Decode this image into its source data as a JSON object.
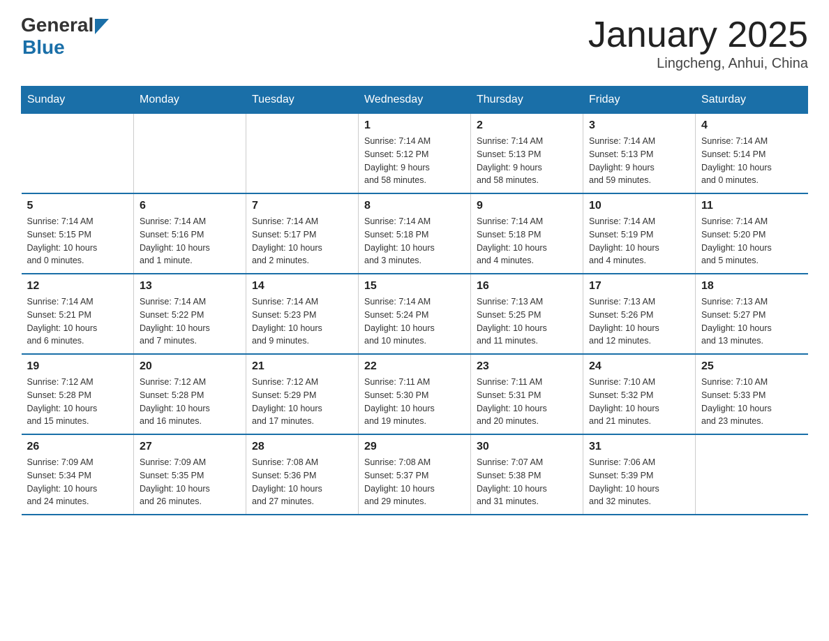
{
  "header": {
    "logo_general": "General",
    "logo_blue": "Blue",
    "month_title": "January 2025",
    "location": "Lingcheng, Anhui, China"
  },
  "weekdays": [
    "Sunday",
    "Monday",
    "Tuesday",
    "Wednesday",
    "Thursday",
    "Friday",
    "Saturday"
  ],
  "weeks": [
    {
      "days": [
        {
          "number": "",
          "info": ""
        },
        {
          "number": "",
          "info": ""
        },
        {
          "number": "",
          "info": ""
        },
        {
          "number": "1",
          "info": "Sunrise: 7:14 AM\nSunset: 5:12 PM\nDaylight: 9 hours\nand 58 minutes."
        },
        {
          "number": "2",
          "info": "Sunrise: 7:14 AM\nSunset: 5:13 PM\nDaylight: 9 hours\nand 58 minutes."
        },
        {
          "number": "3",
          "info": "Sunrise: 7:14 AM\nSunset: 5:13 PM\nDaylight: 9 hours\nand 59 minutes."
        },
        {
          "number": "4",
          "info": "Sunrise: 7:14 AM\nSunset: 5:14 PM\nDaylight: 10 hours\nand 0 minutes."
        }
      ]
    },
    {
      "days": [
        {
          "number": "5",
          "info": "Sunrise: 7:14 AM\nSunset: 5:15 PM\nDaylight: 10 hours\nand 0 minutes."
        },
        {
          "number": "6",
          "info": "Sunrise: 7:14 AM\nSunset: 5:16 PM\nDaylight: 10 hours\nand 1 minute."
        },
        {
          "number": "7",
          "info": "Sunrise: 7:14 AM\nSunset: 5:17 PM\nDaylight: 10 hours\nand 2 minutes."
        },
        {
          "number": "8",
          "info": "Sunrise: 7:14 AM\nSunset: 5:18 PM\nDaylight: 10 hours\nand 3 minutes."
        },
        {
          "number": "9",
          "info": "Sunrise: 7:14 AM\nSunset: 5:18 PM\nDaylight: 10 hours\nand 4 minutes."
        },
        {
          "number": "10",
          "info": "Sunrise: 7:14 AM\nSunset: 5:19 PM\nDaylight: 10 hours\nand 4 minutes."
        },
        {
          "number": "11",
          "info": "Sunrise: 7:14 AM\nSunset: 5:20 PM\nDaylight: 10 hours\nand 5 minutes."
        }
      ]
    },
    {
      "days": [
        {
          "number": "12",
          "info": "Sunrise: 7:14 AM\nSunset: 5:21 PM\nDaylight: 10 hours\nand 6 minutes."
        },
        {
          "number": "13",
          "info": "Sunrise: 7:14 AM\nSunset: 5:22 PM\nDaylight: 10 hours\nand 7 minutes."
        },
        {
          "number": "14",
          "info": "Sunrise: 7:14 AM\nSunset: 5:23 PM\nDaylight: 10 hours\nand 9 minutes."
        },
        {
          "number": "15",
          "info": "Sunrise: 7:14 AM\nSunset: 5:24 PM\nDaylight: 10 hours\nand 10 minutes."
        },
        {
          "number": "16",
          "info": "Sunrise: 7:13 AM\nSunset: 5:25 PM\nDaylight: 10 hours\nand 11 minutes."
        },
        {
          "number": "17",
          "info": "Sunrise: 7:13 AM\nSunset: 5:26 PM\nDaylight: 10 hours\nand 12 minutes."
        },
        {
          "number": "18",
          "info": "Sunrise: 7:13 AM\nSunset: 5:27 PM\nDaylight: 10 hours\nand 13 minutes."
        }
      ]
    },
    {
      "days": [
        {
          "number": "19",
          "info": "Sunrise: 7:12 AM\nSunset: 5:28 PM\nDaylight: 10 hours\nand 15 minutes."
        },
        {
          "number": "20",
          "info": "Sunrise: 7:12 AM\nSunset: 5:28 PM\nDaylight: 10 hours\nand 16 minutes."
        },
        {
          "number": "21",
          "info": "Sunrise: 7:12 AM\nSunset: 5:29 PM\nDaylight: 10 hours\nand 17 minutes."
        },
        {
          "number": "22",
          "info": "Sunrise: 7:11 AM\nSunset: 5:30 PM\nDaylight: 10 hours\nand 19 minutes."
        },
        {
          "number": "23",
          "info": "Sunrise: 7:11 AM\nSunset: 5:31 PM\nDaylight: 10 hours\nand 20 minutes."
        },
        {
          "number": "24",
          "info": "Sunrise: 7:10 AM\nSunset: 5:32 PM\nDaylight: 10 hours\nand 21 minutes."
        },
        {
          "number": "25",
          "info": "Sunrise: 7:10 AM\nSunset: 5:33 PM\nDaylight: 10 hours\nand 23 minutes."
        }
      ]
    },
    {
      "days": [
        {
          "number": "26",
          "info": "Sunrise: 7:09 AM\nSunset: 5:34 PM\nDaylight: 10 hours\nand 24 minutes."
        },
        {
          "number": "27",
          "info": "Sunrise: 7:09 AM\nSunset: 5:35 PM\nDaylight: 10 hours\nand 26 minutes."
        },
        {
          "number": "28",
          "info": "Sunrise: 7:08 AM\nSunset: 5:36 PM\nDaylight: 10 hours\nand 27 minutes."
        },
        {
          "number": "29",
          "info": "Sunrise: 7:08 AM\nSunset: 5:37 PM\nDaylight: 10 hours\nand 29 minutes."
        },
        {
          "number": "30",
          "info": "Sunrise: 7:07 AM\nSunset: 5:38 PM\nDaylight: 10 hours\nand 31 minutes."
        },
        {
          "number": "31",
          "info": "Sunrise: 7:06 AM\nSunset: 5:39 PM\nDaylight: 10 hours\nand 32 minutes."
        },
        {
          "number": "",
          "info": ""
        }
      ]
    }
  ]
}
